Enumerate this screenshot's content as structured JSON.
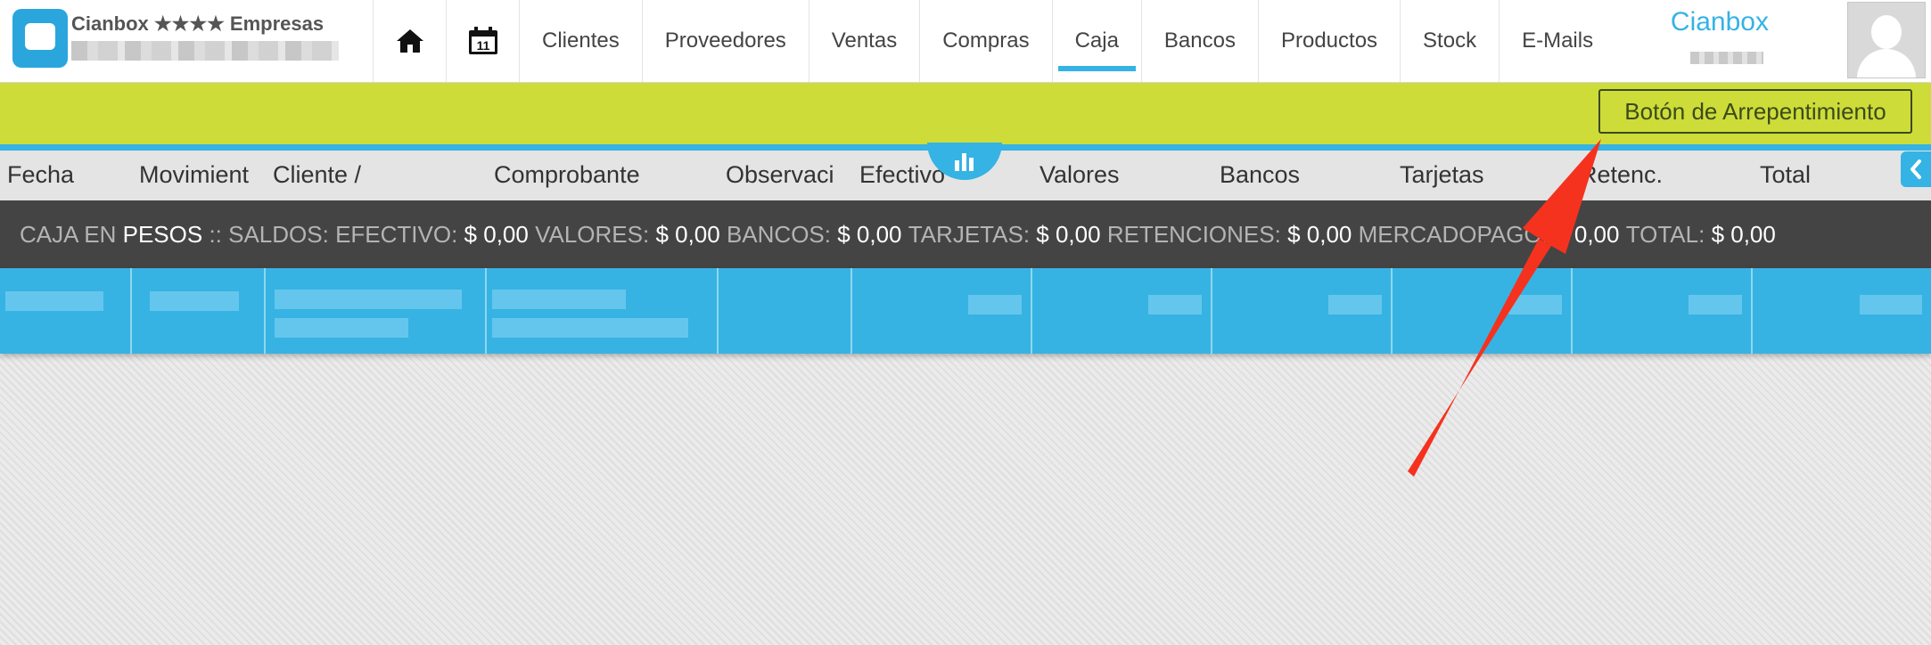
{
  "app": {
    "title": "Cianbox ★★★★ Empresas"
  },
  "nav": {
    "items": [
      {
        "label": "Clientes"
      },
      {
        "label": "Proveedores"
      },
      {
        "label": "Ventas"
      },
      {
        "label": "Compras"
      },
      {
        "label": "Caja"
      },
      {
        "label": "Bancos"
      },
      {
        "label": "Productos"
      },
      {
        "label": "Stock"
      },
      {
        "label": "E-Mails"
      }
    ],
    "active": "Caja",
    "icons": [
      "home-icon",
      "calendar-icon"
    ],
    "calendar_day": "11"
  },
  "user": {
    "name": "Cianbox"
  },
  "action": {
    "arrepentimiento_label": "Botón de Arrepentimiento"
  },
  "table": {
    "columns": [
      "Fecha",
      "Movimient",
      "Cliente /",
      "Comprobante",
      "Observaci",
      "Efectivo",
      "Valores",
      "Bancos",
      "Tarjetas",
      "Retenc.",
      "Total"
    ]
  },
  "summary": {
    "caja_label": "CAJA EN",
    "currency": "PESOS",
    "saldos_label": ":: SALDOS:",
    "items": [
      {
        "label": "EFECTIVO:",
        "value": "$ 0,00"
      },
      {
        "label": "VALORES:",
        "value": "$ 0,00"
      },
      {
        "label": "BANCOS:",
        "value": "$ 0,00"
      },
      {
        "label": "TARJETAS:",
        "value": "$ 0,00"
      },
      {
        "label": "RETENCIONES:",
        "value": "$ 0,00"
      },
      {
        "label": "MERCADOPAGO:",
        "value": "$ 0,00"
      },
      {
        "label": "TOTAL:",
        "value": "$ 0,00"
      }
    ]
  },
  "colors": {
    "accent": "#34b3e4",
    "green_bar": "#cddc39",
    "summary_bg": "#444444",
    "arrow": "#f5321e"
  }
}
